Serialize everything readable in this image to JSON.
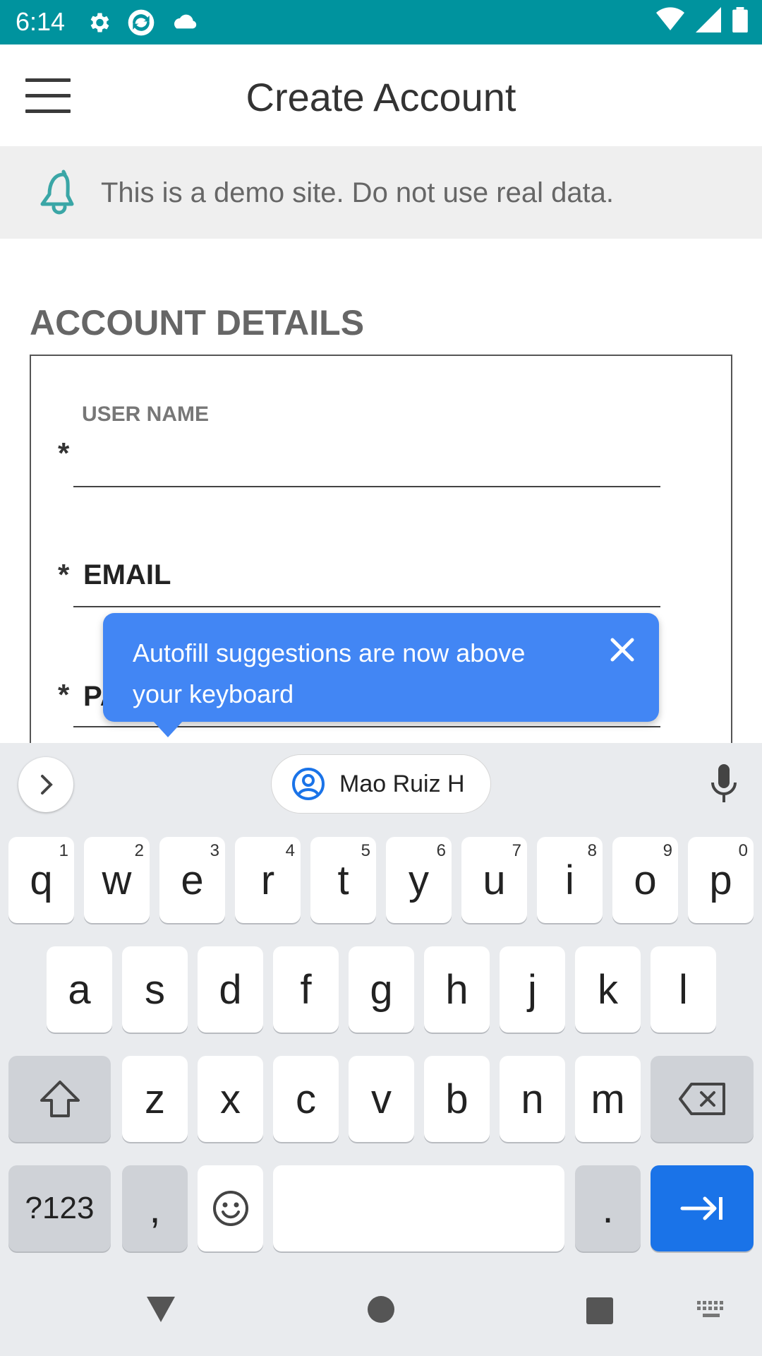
{
  "status_bar": {
    "time": "6:14"
  },
  "app_bar": {
    "title": "Create Account"
  },
  "banner": {
    "text": "This is a demo site. Do not use real data."
  },
  "form": {
    "section_title": "ACCOUNT DETAILS",
    "required_marker": "*",
    "fields": [
      {
        "label": "USER NAME",
        "value": ""
      },
      {
        "label": "EMAIL",
        "value": ""
      },
      {
        "label": "PA",
        "value": ""
      }
    ]
  },
  "tooltip": {
    "text": "Autofill suggestions are now above your keyboard"
  },
  "keyboard": {
    "suggestion": "Mao Ruiz H",
    "row1": [
      {
        "k": "q",
        "h": "1"
      },
      {
        "k": "w",
        "h": "2"
      },
      {
        "k": "e",
        "h": "3"
      },
      {
        "k": "r",
        "h": "4"
      },
      {
        "k": "t",
        "h": "5"
      },
      {
        "k": "y",
        "h": "6"
      },
      {
        "k": "u",
        "h": "7"
      },
      {
        "k": "i",
        "h": "8"
      },
      {
        "k": "o",
        "h": "9"
      },
      {
        "k": "p",
        "h": "0"
      }
    ],
    "row2": [
      "a",
      "s",
      "d",
      "f",
      "g",
      "h",
      "j",
      "k",
      "l"
    ],
    "row3": [
      "z",
      "x",
      "c",
      "v",
      "b",
      "n",
      "m"
    ],
    "symbols_label": "?123",
    "comma_label": ",",
    "period_label": "."
  },
  "colors": {
    "status_bar": "#00939e",
    "tooltip": "#4286f4",
    "enter_key": "#1a73e8",
    "bell_icon": "#3aa6a6"
  }
}
